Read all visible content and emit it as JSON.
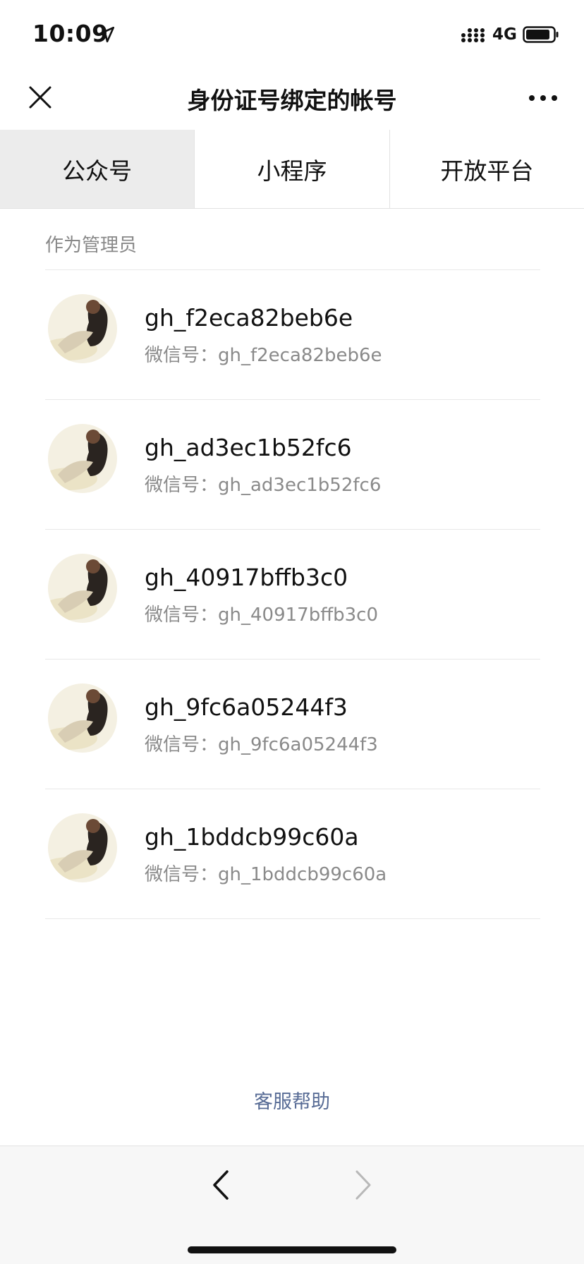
{
  "status_bar": {
    "time": "10:09",
    "network": "4G",
    "icons": [
      "location-arrow-icon",
      "signal-icon",
      "battery-icon"
    ]
  },
  "nav": {
    "title": "身份证号绑定的帐号",
    "close_icon": "close-icon",
    "more_icon": "more-icon"
  },
  "tabs": [
    {
      "label": "公众号",
      "active": true
    },
    {
      "label": "小程序",
      "active": false
    },
    {
      "label": "开放平台",
      "active": false
    }
  ],
  "section_label": "作为管理员",
  "accounts": [
    {
      "name": "gh_f2eca82beb6e",
      "wechat_id": "微信号：gh_f2eca82beb6e"
    },
    {
      "name": "gh_ad3ec1b52fc6",
      "wechat_id": "微信号：gh_ad3ec1b52fc6"
    },
    {
      "name": "gh_40917bffb3c0",
      "wechat_id": "微信号：gh_40917bffb3c0"
    },
    {
      "name": "gh_9fc6a05244f3",
      "wechat_id": "微信号：gh_9fc6a05244f3"
    },
    {
      "name": "gh_1bddcb99c60a",
      "wechat_id": "微信号：gh_1bddcb99c60a"
    }
  ],
  "help_link": "客服帮助",
  "toolbar": {
    "back_icon": "chevron-left-icon",
    "forward_icon": "chevron-right-icon"
  },
  "colors": {
    "link": "#576b95",
    "active_tab_bg": "#ececec",
    "secondary_text": "#8a8a8a"
  }
}
